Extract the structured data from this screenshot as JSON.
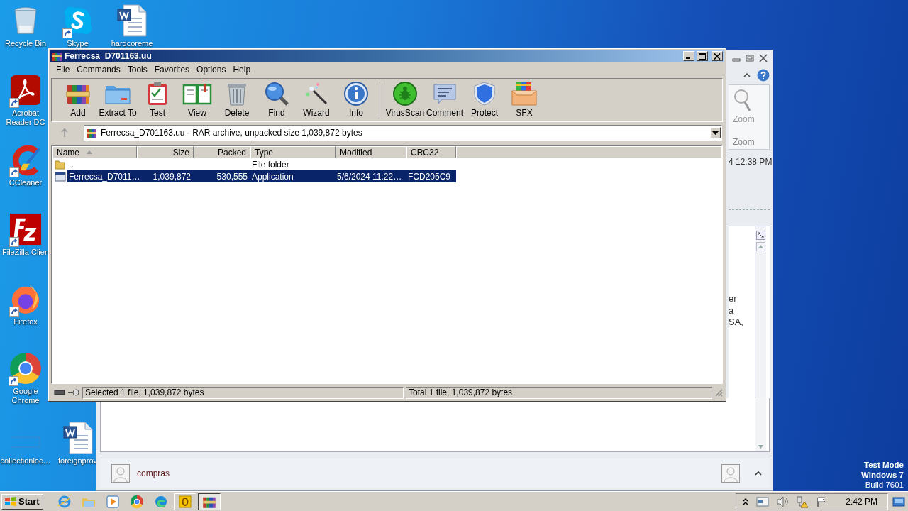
{
  "desktop": {
    "icons": [
      {
        "label": "Recycle Bin",
        "kind": "recycle",
        "shortcut": false
      },
      {
        "label": "Skype",
        "kind": "skype",
        "shortcut": true
      },
      {
        "label": "hardcoreme",
        "kind": "word",
        "shortcut": false
      },
      {
        "label": "Acrobat Reader DC",
        "kind": "acrobat",
        "shortcut": true
      },
      {
        "label": "CCleaner",
        "kind": "ccleaner",
        "shortcut": true
      },
      {
        "label": "FileZilla Clien",
        "kind": "filezilla",
        "shortcut": true
      },
      {
        "label": "Firefox",
        "kind": "firefox",
        "shortcut": true
      },
      {
        "label": "Google Chrome",
        "kind": "chrome",
        "shortcut": true
      },
      {
        "label": "collectionloc…",
        "kind": "blank",
        "shortcut": false
      },
      {
        "label": "foreignprov",
        "kind": "word",
        "shortcut": false
      }
    ],
    "os_notice": [
      "Test Mode",
      "Windows 7",
      "Build 7601"
    ]
  },
  "outlook_window": {
    "ribbon": {
      "button": "Zoom",
      "group": "Zoom"
    },
    "received": "4 12:38 PM",
    "preview_fragments": [
      "er",
      "a",
      "SA,"
    ],
    "people_pane": {
      "name": "compras"
    }
  },
  "winrar": {
    "title": "Ferrecsa_D701163.uu",
    "menu": [
      "File",
      "Commands",
      "Tools",
      "Favorites",
      "Options",
      "Help"
    ],
    "toolbar": [
      {
        "label": "Add",
        "kind": "add"
      },
      {
        "label": "Extract To",
        "kind": "extract"
      },
      {
        "label": "Test",
        "kind": "test"
      },
      {
        "label": "View",
        "kind": "view"
      },
      {
        "label": "Delete",
        "kind": "delete"
      },
      {
        "label": "Find",
        "kind": "find"
      },
      {
        "label": "Wizard",
        "kind": "wizard"
      },
      {
        "label": "Info",
        "kind": "info"
      },
      {
        "label": "VirusScan",
        "kind": "virusscan"
      },
      {
        "label": "Comment",
        "kind": "comment"
      },
      {
        "label": "Protect",
        "kind": "protect"
      },
      {
        "label": "SFX",
        "kind": "sfx"
      }
    ],
    "address": "Ferrecsa_D701163.uu - RAR archive, unpacked size 1,039,872 bytes",
    "columns": [
      {
        "label": "Name",
        "sorted": true
      },
      {
        "label": "Size",
        "sorted": false
      },
      {
        "label": "Packed",
        "sorted": false
      },
      {
        "label": "Type",
        "sorted": false
      },
      {
        "label": "Modified",
        "sorted": false
      },
      {
        "label": "CRC32",
        "sorted": false
      }
    ],
    "rows": [
      {
        "kind": "folder",
        "selected": false,
        "cells": [
          "..",
          "",
          "",
          "File folder",
          "",
          ""
        ]
      },
      {
        "kind": "application",
        "selected": true,
        "cells": [
          "Ferrecsa_D7011…",
          "1,039,872",
          "530,555",
          "Application",
          "5/6/2024 11:22…",
          "FCD205C9"
        ]
      }
    ],
    "status_left": "Selected 1 file, 1,039,872 bytes",
    "status_right": "Total 1 file, 1,039,872 bytes"
  },
  "taskbar": {
    "start": "Start",
    "apps": [
      {
        "kind": "ie",
        "open": false,
        "selected": false
      },
      {
        "kind": "explorer",
        "open": false,
        "selected": false
      },
      {
        "kind": "media",
        "open": false,
        "selected": false
      },
      {
        "kind": "chrome",
        "open": false,
        "selected": false
      },
      {
        "kind": "edge",
        "open": false,
        "selected": false
      },
      {
        "kind": "outlook",
        "open": true,
        "selected": false
      },
      {
        "kind": "winrar",
        "open": true,
        "selected": true
      }
    ],
    "clock": "2:42 PM"
  }
}
